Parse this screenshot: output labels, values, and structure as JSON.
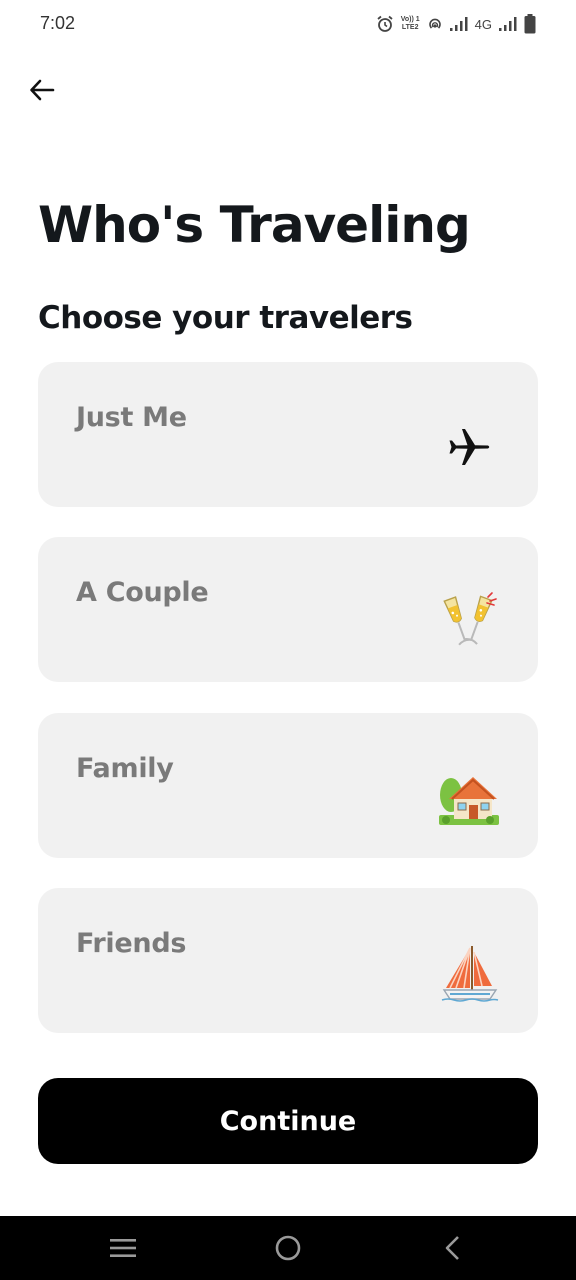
{
  "status_bar": {
    "time": "7:02",
    "lte_label_top": "Vo)) 1",
    "lte_label_bottom": "LTE2",
    "network_label": "4G",
    "icons": [
      "alarm-icon",
      "volte-icon",
      "hotspot-icon",
      "signal-icon",
      "signal-icon",
      "battery-icon"
    ]
  },
  "header": {
    "back_icon": "arrow-left-icon"
  },
  "page": {
    "title": "Who's Traveling",
    "subtitle": "Choose your travelers"
  },
  "options": [
    {
      "label": "Just Me",
      "icon": "airplane-icon"
    },
    {
      "label": "A Couple",
      "icon": "champagne-glasses-icon"
    },
    {
      "label": "Family",
      "icon": "house-icon"
    },
    {
      "label": "Friends",
      "icon": "sailboat-icon"
    }
  ],
  "continue_label": "Continue",
  "nav_bar": {
    "icons": [
      "menu-icon",
      "home-circle-icon",
      "back-chevron-icon"
    ],
    "background": "#000000"
  },
  "colors": {
    "card_background": "#f1f1f1",
    "card_label": "#7a7a7a",
    "button_background": "#000000",
    "button_text": "#ffffff"
  }
}
